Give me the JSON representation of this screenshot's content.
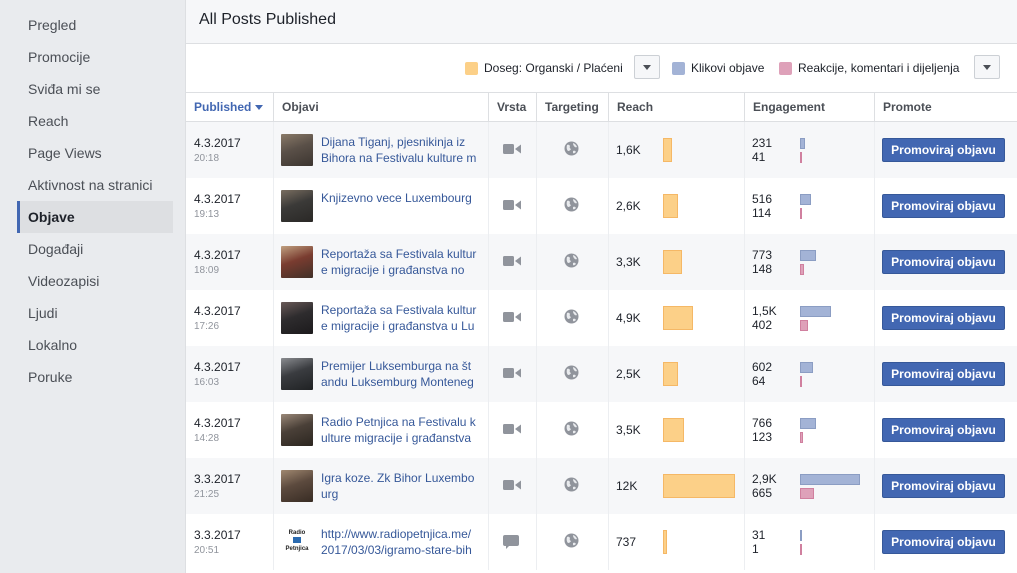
{
  "sidebar": {
    "items": [
      {
        "label": "Pregled",
        "active": false
      },
      {
        "label": "Promocije",
        "active": false
      },
      {
        "label": "Sviđa mi se",
        "active": false
      },
      {
        "label": "Reach",
        "active": false
      },
      {
        "label": "Page Views",
        "active": false
      },
      {
        "label": "Aktivnost na stranici",
        "active": false
      },
      {
        "label": "Objave",
        "active": true
      },
      {
        "label": "Događaji",
        "active": false
      },
      {
        "label": "Videozapisi",
        "active": false
      },
      {
        "label": "Ljudi",
        "active": false
      },
      {
        "label": "Lokalno",
        "active": false
      },
      {
        "label": "Poruke",
        "active": false
      }
    ]
  },
  "header": {
    "title": "All Posts Published"
  },
  "legend": {
    "reach_label": "Doseg: Organski / Plaćeni",
    "clicks_label": "Klikovi objave",
    "reactions_label": "Reakcije, komentari i dijeljenja",
    "colors": {
      "reach": "#fcd088",
      "clicks": "#a3b3d6",
      "reactions": "#dea1b9"
    }
  },
  "columns": {
    "published": "Published",
    "posts": "Objavi",
    "type": "Vrsta",
    "targeting": "Targeting",
    "reach": "Reach",
    "engagement": "Engagement",
    "promote": "Promote"
  },
  "posts": [
    {
      "date": "4.3.2017",
      "time": "20:18",
      "title": "Dijana Tiganj, pjesnikinja iz\nBihora na Festivalu kulture m",
      "type_icon": "video-camera-icon",
      "reach": "1,6K",
      "reach_fraction": 0.13,
      "clicks": "231",
      "reactions": "41",
      "clicks_fraction": 0.08,
      "reactions_fraction": 0.04,
      "button": "Promoviraj objavu"
    },
    {
      "date": "4.3.2017",
      "time": "19:13",
      "title": "Knjizevno vece Luxembourg",
      "type_icon": "video-camera-icon",
      "reach": "2,6K",
      "reach_fraction": 0.21,
      "clicks": "516",
      "reactions": "114",
      "clicks_fraction": 0.18,
      "reactions_fraction": 0.04,
      "button": "Promoviraj objavu"
    },
    {
      "date": "4.3.2017",
      "time": "18:09",
      "title": "Reportaža sa Festivala kultur\ne migracije i građanstva no",
      "type_icon": "video-camera-icon",
      "reach": "3,3K",
      "reach_fraction": 0.27,
      "clicks": "773",
      "reactions": "148",
      "clicks_fraction": 0.27,
      "reactions_fraction": 0.07,
      "button": "Promoviraj objavu"
    },
    {
      "date": "4.3.2017",
      "time": "17:26",
      "title": "Reportaža sa Festivala kultur\ne migracije i građanstva u Lu",
      "type_icon": "video-camera-icon",
      "reach": "4,9K",
      "reach_fraction": 0.41,
      "clicks": "1,5K",
      "reactions": "402",
      "clicks_fraction": 0.52,
      "reactions_fraction": 0.14,
      "button": "Promoviraj objavu"
    },
    {
      "date": "4.3.2017",
      "time": "16:03",
      "title": "Premijer Luksemburga na št\nandu Luksemburg Monteneg",
      "type_icon": "video-camera-icon",
      "reach": "2,5K",
      "reach_fraction": 0.21,
      "clicks": "602",
      "reactions": "64",
      "clicks_fraction": 0.21,
      "reactions_fraction": 0.03,
      "button": "Promoviraj objavu"
    },
    {
      "date": "4.3.2017",
      "time": "14:28",
      "title": "Radio Petnjica na Festivalu k\nulture migracije i građanstva",
      "type_icon": "video-camera-icon",
      "reach": "3,5K",
      "reach_fraction": 0.29,
      "clicks": "766",
      "reactions": "123",
      "clicks_fraction": 0.27,
      "reactions_fraction": 0.05,
      "button": "Promoviraj objavu"
    },
    {
      "date": "3.3.2017",
      "time": "21:25",
      "title": "Igra koze. Zk Bihor Luxembo\nurg",
      "type_icon": "video-camera-icon",
      "reach": "12K",
      "reach_fraction": 1.0,
      "clicks": "2,9K",
      "reactions": "665",
      "clicks_fraction": 1.0,
      "reactions_fraction": 0.23,
      "button": "Promoviraj objavu"
    },
    {
      "date": "3.3.2017",
      "time": "20:51",
      "title": "http://www.radiopetnjica.me/\n2017/03/03/igramo-stare-bih",
      "type_icon": "status-bubble-icon",
      "reach": "737",
      "reach_fraction": 0.06,
      "clicks": "31",
      "reactions": "1",
      "clicks_fraction": 0.01,
      "reactions_fraction": 0.0,
      "button": "Promoviraj objavu"
    }
  ]
}
